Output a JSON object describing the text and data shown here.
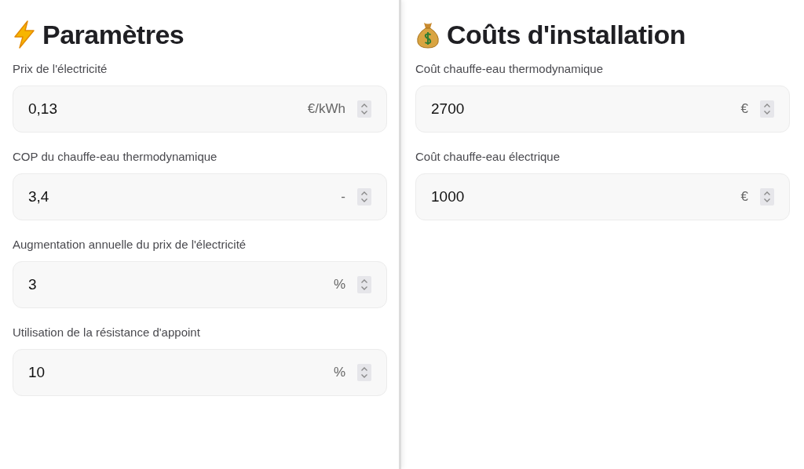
{
  "panels": [
    {
      "kind": "bolt",
      "title": "Paramètres",
      "fields": [
        {
          "label": "Prix de l'électricité",
          "value": "0,13",
          "unit": "€/kWh"
        },
        {
          "label": "COP du chauffe-eau thermodynamique",
          "value": "3,4",
          "unit": "-"
        },
        {
          "label": "Augmentation annuelle du prix de l'électricité",
          "value": "3",
          "unit": "%"
        },
        {
          "label": "Utilisation de la résistance d'appoint",
          "value": "10",
          "unit": "%"
        }
      ]
    },
    {
      "kind": "money-bag",
      "title": "Coûts d'installation",
      "fields": [
        {
          "label": "Coût chauffe-eau thermodynamique",
          "value": "2700",
          "unit": "€"
        },
        {
          "label": "Coût chauffe-eau électrique",
          "value": "1000",
          "unit": "€"
        }
      ]
    }
  ]
}
